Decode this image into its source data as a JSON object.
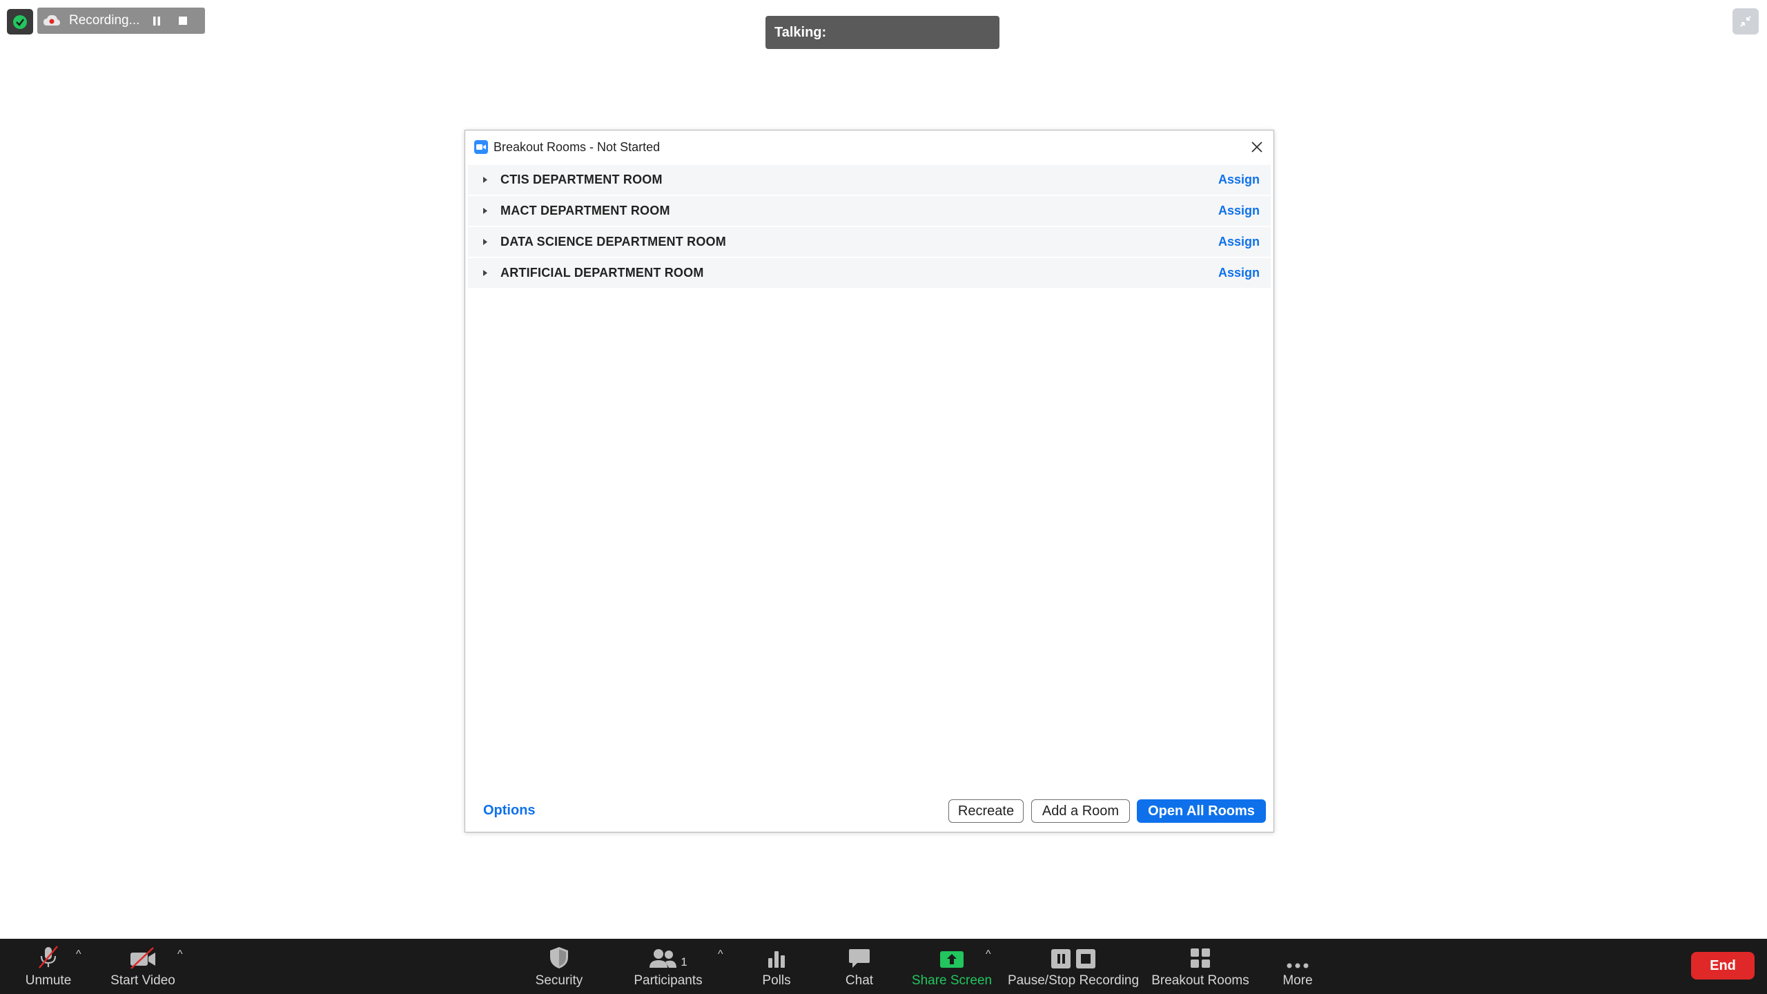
{
  "recording": {
    "label": "Recording..."
  },
  "talking": {
    "label": "Talking:"
  },
  "dialog": {
    "title": "Breakout Rooms - Not Started",
    "rooms": [
      {
        "name": "CTIS DEPARTMENT ROOM",
        "action": "Assign"
      },
      {
        "name": "MACT DEPARTMENT ROOM",
        "action": "Assign"
      },
      {
        "name": "DATA SCIENCE DEPARTMENT ROOM",
        "action": "Assign"
      },
      {
        "name": "ARTIFICIAL DEPARTMENT ROOM",
        "action": "Assign"
      }
    ],
    "options_label": "Options",
    "buttons": {
      "recreate": "Recreate",
      "add_room": "Add a Room",
      "open_all": "Open All Rooms"
    }
  },
  "toolbar": {
    "unmute": "Unmute",
    "start_video": "Start Video",
    "security": "Security",
    "participants": "Participants",
    "participants_count": "1",
    "polls": "Polls",
    "chat": "Chat",
    "share_screen": "Share Screen",
    "pause_stop_recording": "Pause/Stop Recording",
    "breakout_rooms": "Breakout Rooms",
    "more": "More",
    "end": "End"
  },
  "colors": {
    "accent": "#0e71eb",
    "share": "#22c55e",
    "end": "#e02828",
    "toolbar_bg": "#1a1a1a"
  },
  "icons": [
    "shield-icon",
    "cloud-record-icon",
    "pause-icon",
    "stop-icon",
    "exit-fullscreen-icon",
    "zoom-app-icon",
    "close-icon",
    "caret-right-icon",
    "mic-muted-icon",
    "video-off-icon",
    "security-shield-icon",
    "participants-icon",
    "polls-icon",
    "chat-icon",
    "share-screen-icon",
    "breakout-rooms-icon",
    "more-icon"
  ]
}
